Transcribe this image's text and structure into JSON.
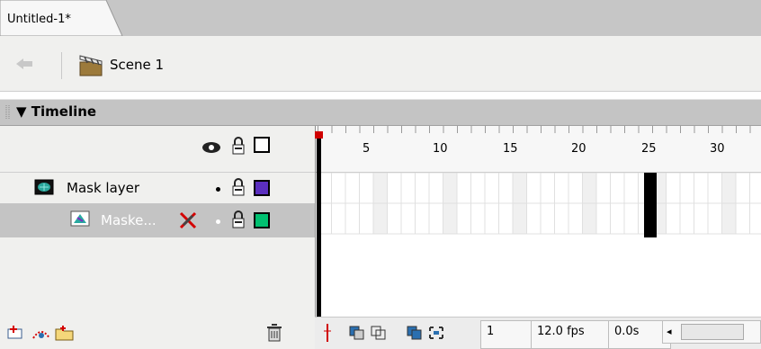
{
  "document_tab": {
    "title": "Untitled-1*"
  },
  "scene_bar": {
    "scene_label": "Scene 1"
  },
  "timeline": {
    "title": "Timeline",
    "frame_numbers": [
      "5",
      "10",
      "15",
      "20",
      "25",
      "30"
    ],
    "layers": [
      {
        "name": "Mask layer",
        "outline_color": "#5b2fbf"
      },
      {
        "name": "Maske...",
        "outline_color": "#00c070"
      }
    ],
    "status": {
      "current_frame": "1",
      "frame_rate": "12.0 fps",
      "elapsed_time": "0.0s"
    }
  },
  "colors": {
    "tab_bg": "#f7f7f7",
    "timeline_header": "#c4c4c4",
    "selected_row": "#c4c4c4",
    "keyframe_black": "#000000",
    "playhead_red": "#d00000"
  },
  "icons": {
    "back": "back-arrow-icon",
    "scene": "clapperboard-icon",
    "eye": "eye-icon",
    "lock": "lock-icon",
    "outline": "outline-icon",
    "mask_layer": "mask-layer-icon",
    "masked_layer": "masked-layer-icon",
    "pencil_cross": "pencil-cross-icon",
    "trash": "trash-icon"
  }
}
